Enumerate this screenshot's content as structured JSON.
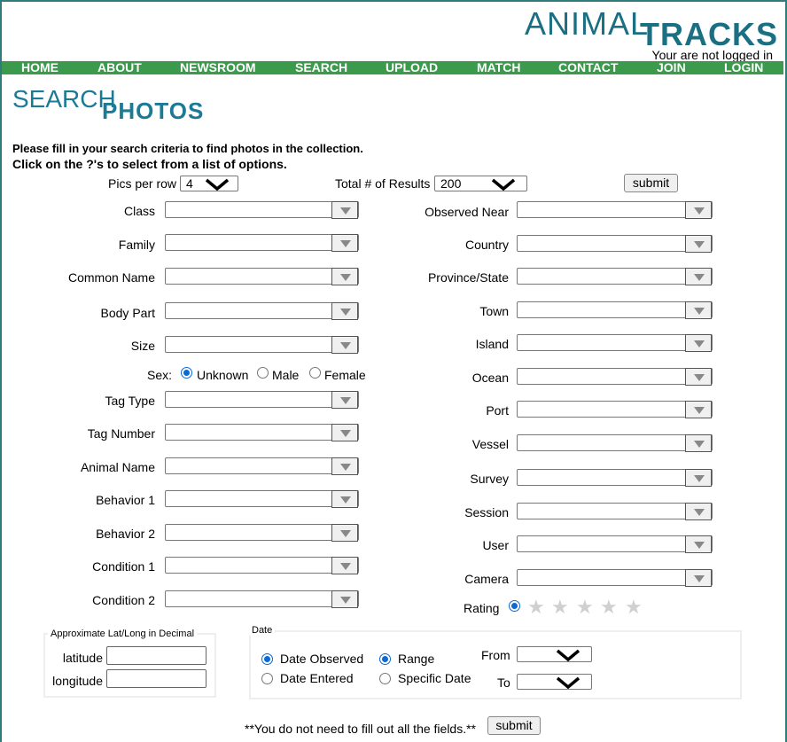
{
  "brand": {
    "logo_part1": "ANIMAL",
    "logo_part2": "TRACKS"
  },
  "status": {
    "login_text": "Your are not logged in"
  },
  "nav": [
    "HOME",
    "ABOUT",
    "NEWSROOM",
    "SEARCH",
    "UPLOAD",
    "MATCH",
    "CONTACT",
    "JOIN",
    "LOGIN"
  ],
  "page_title": {
    "part1": "SEARCH",
    "part2": "PHOTOS"
  },
  "instructions": {
    "line1": "Please fill in your search criteria to find photos in the collection.",
    "line2": "Click on the ?'s to select from a list of options."
  },
  "controls": {
    "pics_label": "Pics per row",
    "pics_value": "4",
    "total_label": "Total # of Results",
    "total_value": "200",
    "submit_label": "submit"
  },
  "left_fields": [
    "Class",
    "Family",
    "Common Name",
    "Body Part",
    "Size"
  ],
  "sex": {
    "label": "Sex:",
    "options": [
      "Unknown",
      "Male",
      "Female"
    ],
    "selected": "Unknown"
  },
  "left_fields2": [
    "Tag Type",
    "Tag Number",
    "Animal Name",
    "Behavior 1",
    "Behavior 2",
    "Condition 1",
    "Condition 2"
  ],
  "right_fields": [
    "Observed Near",
    "Country",
    "Province/State",
    "Town",
    "Island",
    "Ocean",
    "Port",
    "Vessel",
    "Survey",
    "Session",
    "User",
    "Camera"
  ],
  "rating": {
    "label": "Rating",
    "stars": 5,
    "value": 0
  },
  "latlong": {
    "legend": "Approximate Lat/Long in Decimal",
    "latitude": "latitude",
    "longitude": "longitude"
  },
  "date": {
    "legend": "Date",
    "type_options": [
      "Date Observed",
      "Date Entered"
    ],
    "type_selected": "Date Observed",
    "mode_options": [
      "Range",
      "Specific Date"
    ],
    "mode_selected": "Range",
    "from_label": "From",
    "to_label": "To"
  },
  "footer": {
    "note": "**You do not need to fill out all the fields.**",
    "submit_label": "submit"
  },
  "colors": {
    "nav_bg": "#3b9a4b",
    "brand": "#1b6f82",
    "frame": "#2e7d7a",
    "radio": "#0b6ad4"
  }
}
